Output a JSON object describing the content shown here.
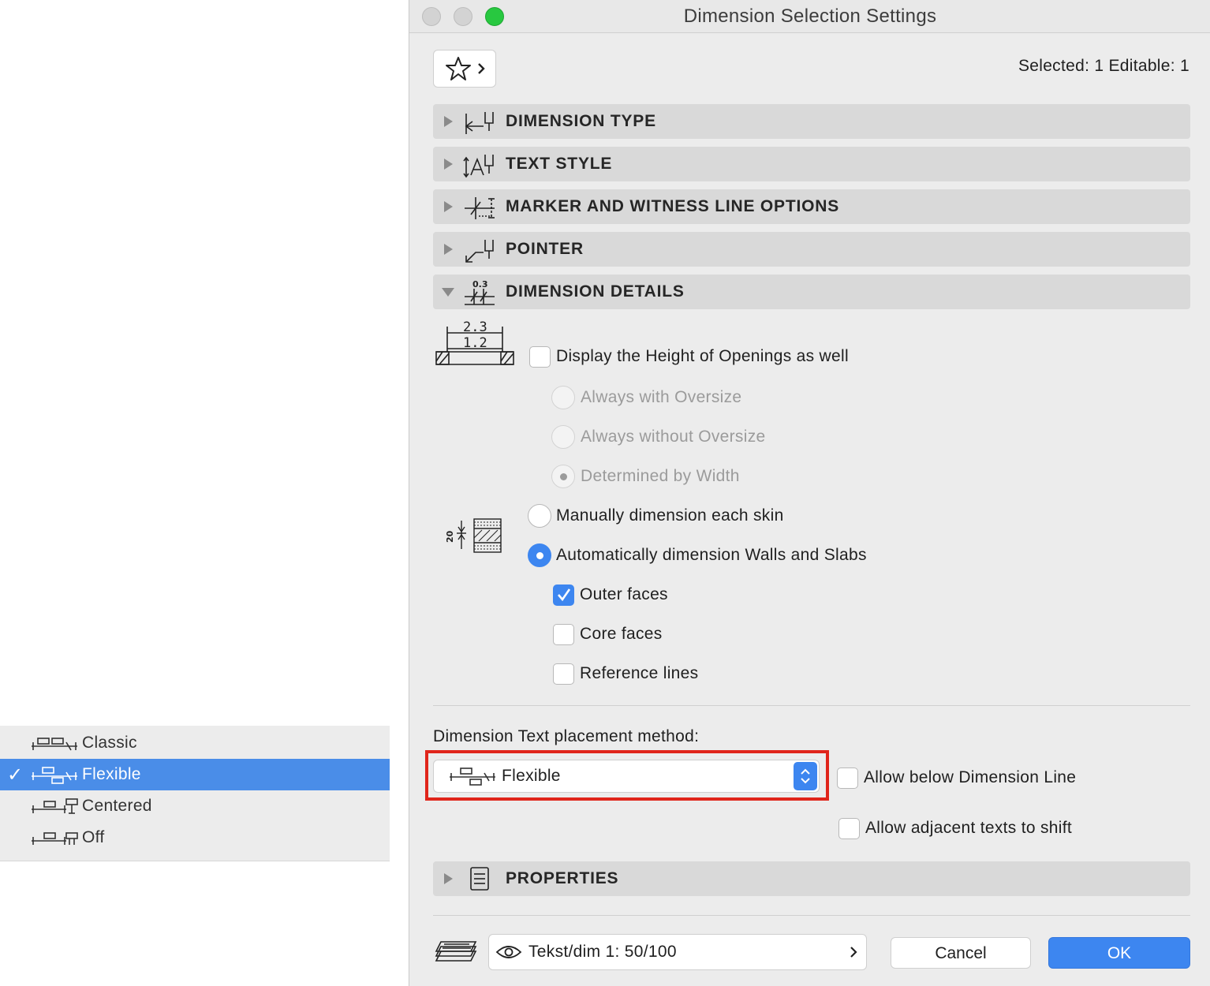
{
  "menu": {
    "items": [
      {
        "label": "Classic",
        "icon": "classic-placement-icon",
        "selected": false
      },
      {
        "label": "Flexible",
        "icon": "flexible-placement-icon",
        "selected": true
      },
      {
        "label": "Centered",
        "icon": "centered-placement-icon",
        "selected": false
      },
      {
        "label": "Off",
        "icon": "off-placement-icon",
        "selected": false
      }
    ],
    "check_glyph": "✓"
  },
  "window": {
    "title": "Dimension Selection Settings",
    "traffic_lights": {
      "close": "#d0d0d0",
      "minimize": "#d0d0d0",
      "zoom": "#28c840"
    },
    "selected_info": "Selected: 1 Editable: 1"
  },
  "sections": {
    "dimension_type": "DIMENSION TYPE",
    "text_style": "TEXT STYLE",
    "marker": "MARKER AND WITNESS LINE OPTIONS",
    "pointer": "POINTER",
    "details": "DIMENSION DETAILS",
    "details_icon_value": "0.3",
    "properties": "PROPERTIES"
  },
  "details": {
    "openings_icon_top": "2.3",
    "openings_icon_bottom": "1.2",
    "display_height": {
      "label": "Display the Height of Openings as well",
      "checked": false
    },
    "oversize_options": [
      {
        "label": "Always with Oversize",
        "selected": false,
        "enabled": false
      },
      {
        "label": "Always without Oversize",
        "selected": false,
        "enabled": false
      },
      {
        "label": "Determined by Width",
        "selected": true,
        "enabled": false
      }
    ],
    "skin_icon_value": "20",
    "manual": {
      "label": "Manually dimension each skin",
      "selected": false
    },
    "automatic": {
      "label": "Automatically dimension Walls and Slabs",
      "selected": true
    },
    "outer_faces": {
      "label": "Outer faces",
      "checked": true
    },
    "core_faces": {
      "label": "Core faces",
      "checked": false
    },
    "reference_lines": {
      "label": "Reference lines",
      "checked": false
    }
  },
  "placement": {
    "label": "Dimension Text placement method:",
    "value": "Flexible",
    "allow_below": {
      "label": "Allow below Dimension Line",
      "checked": false
    },
    "allow_shift": {
      "label": "Allow adjacent texts to shift",
      "checked": false
    }
  },
  "footer": {
    "layer": "Tekst/dim 1: 50/100",
    "cancel": "Cancel",
    "ok": "OK"
  },
  "colors": {
    "accent": "#3d86f0",
    "highlight": "#e0251b",
    "menu_selected": "#4a8de8"
  }
}
